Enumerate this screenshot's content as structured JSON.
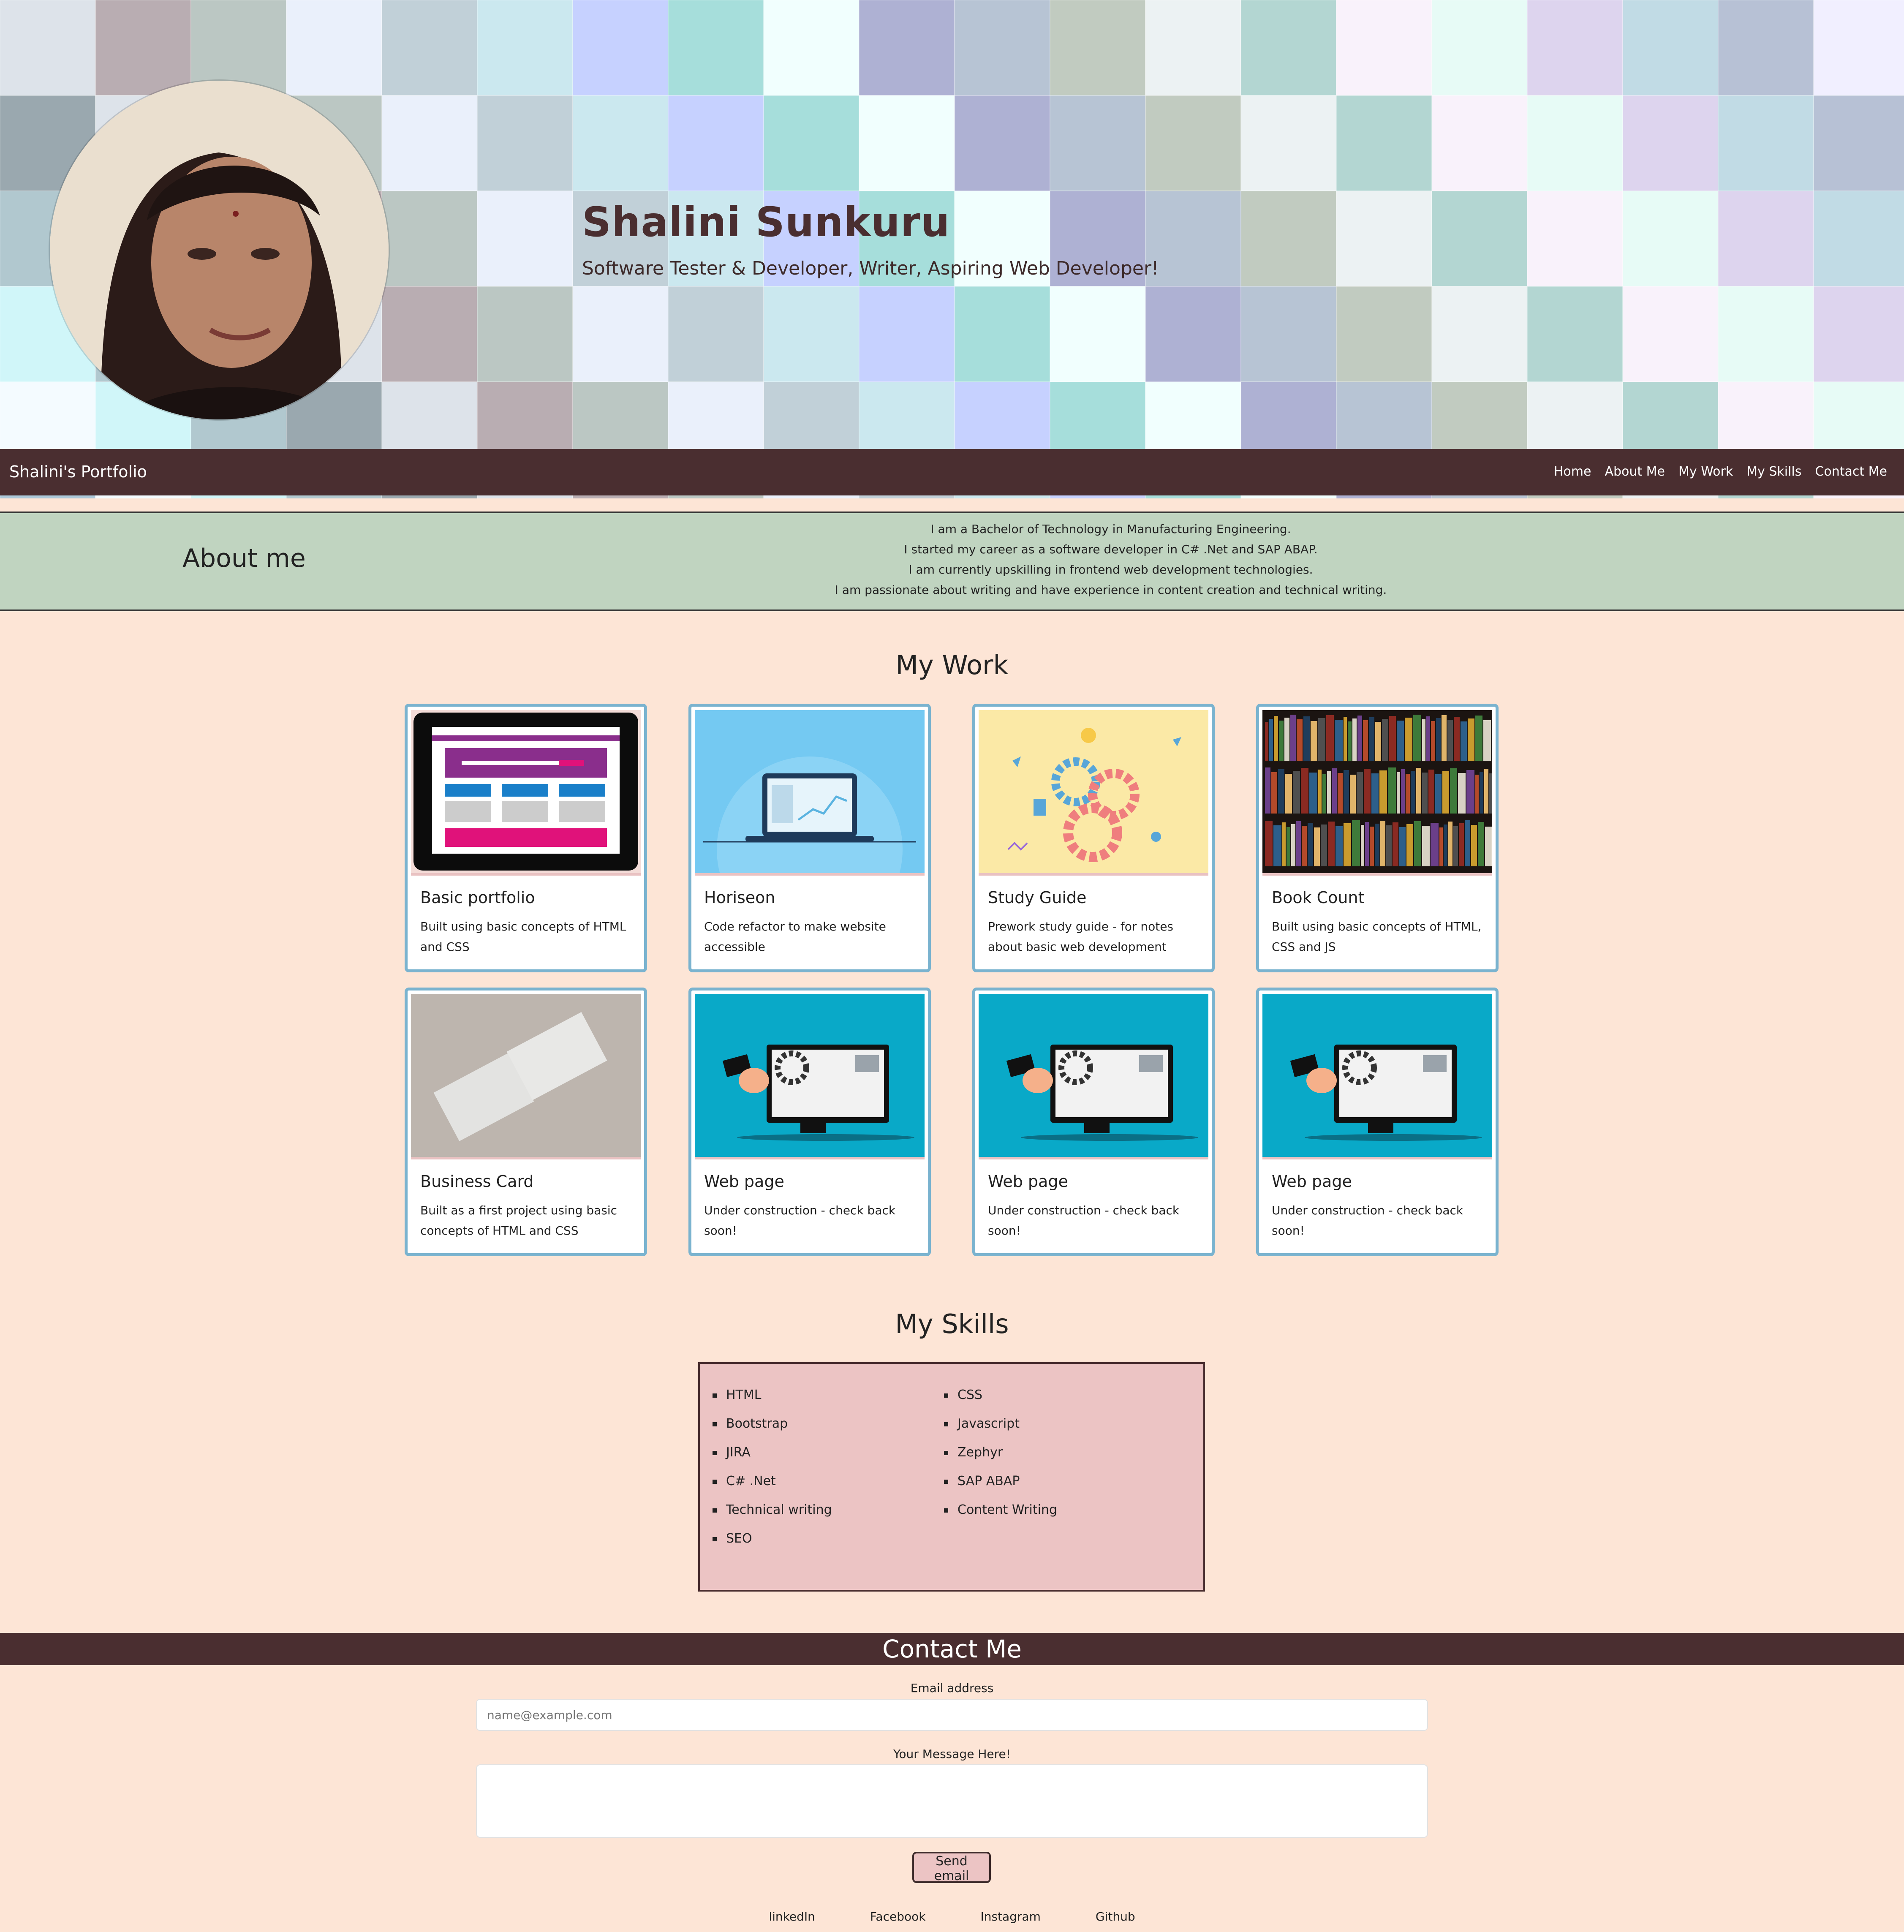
{
  "hero": {
    "name": "Shalini Sunkuru",
    "tagline": "Software Tester & Developer, Writer, Aspiring Web Developer!"
  },
  "navbar": {
    "brand": "Shalini's Portfolio",
    "links": [
      "Home",
      "About Me",
      "My Work",
      "My Skills",
      "Contact Me"
    ]
  },
  "about": {
    "title": "About me",
    "lines": [
      "I am a Bachelor of Technology in Manufacturing Engineering.",
      "I started my career as a software developer in C# .Net and SAP ABAP.",
      "I am currently upskilling in frontend web development technologies.",
      "I am passionate about writing and have experience in content creation and technical writing."
    ]
  },
  "work": {
    "title": "My Work",
    "cards": [
      {
        "title": "Basic portfolio",
        "desc": "Built using basic concepts of HTML and CSS",
        "image": "tablet-website-mockup"
      },
      {
        "title": "Horiseon",
        "desc": "Code refactor to make website accessible",
        "image": "laptop-analytics"
      },
      {
        "title": "Study Guide",
        "desc": "Prework study guide - for notes about basic web development",
        "image": "gears-illustration"
      },
      {
        "title": "Book Count",
        "desc": "Built using basic concepts of HTML, CSS and JS",
        "image": "bookshelf"
      },
      {
        "title": "Business Card",
        "desc": "Built as a first project using basic concepts of HTML and CSS",
        "image": "business-cards"
      },
      {
        "title": "Web page",
        "desc": "Under construction - check back soon!",
        "image": "monitor-wrench"
      },
      {
        "title": "Web page",
        "desc": "Under construction - check back soon!",
        "image": "monitor-wrench"
      },
      {
        "title": "Web page",
        "desc": "Under construction - check back soon!",
        "image": "monitor-wrench"
      }
    ]
  },
  "skills": {
    "title": "My Skills",
    "left": [
      "HTML",
      "Bootstrap",
      "JIRA",
      "C# .Net",
      "Technical writing",
      "SEO"
    ],
    "right": [
      "CSS",
      "Javascript",
      "Zephyr",
      "SAP ABAP",
      "Content Writing"
    ]
  },
  "contact": {
    "title": "Contact Me",
    "email_label": "Email address",
    "email_placeholder": "name@example.com",
    "message_label": "Your Message Here!",
    "send_label": "Send email"
  },
  "footer": {
    "links": [
      "linkedIn",
      "Facebook",
      "Instagram",
      "Github"
    ]
  },
  "colors": {
    "page_bg": "#fde5d6",
    "nav_bg": "#4a2e30",
    "about_bg": "#c0d4c0",
    "card_border": "#7ab3cf",
    "skills_bg": "#ecc4c4"
  }
}
